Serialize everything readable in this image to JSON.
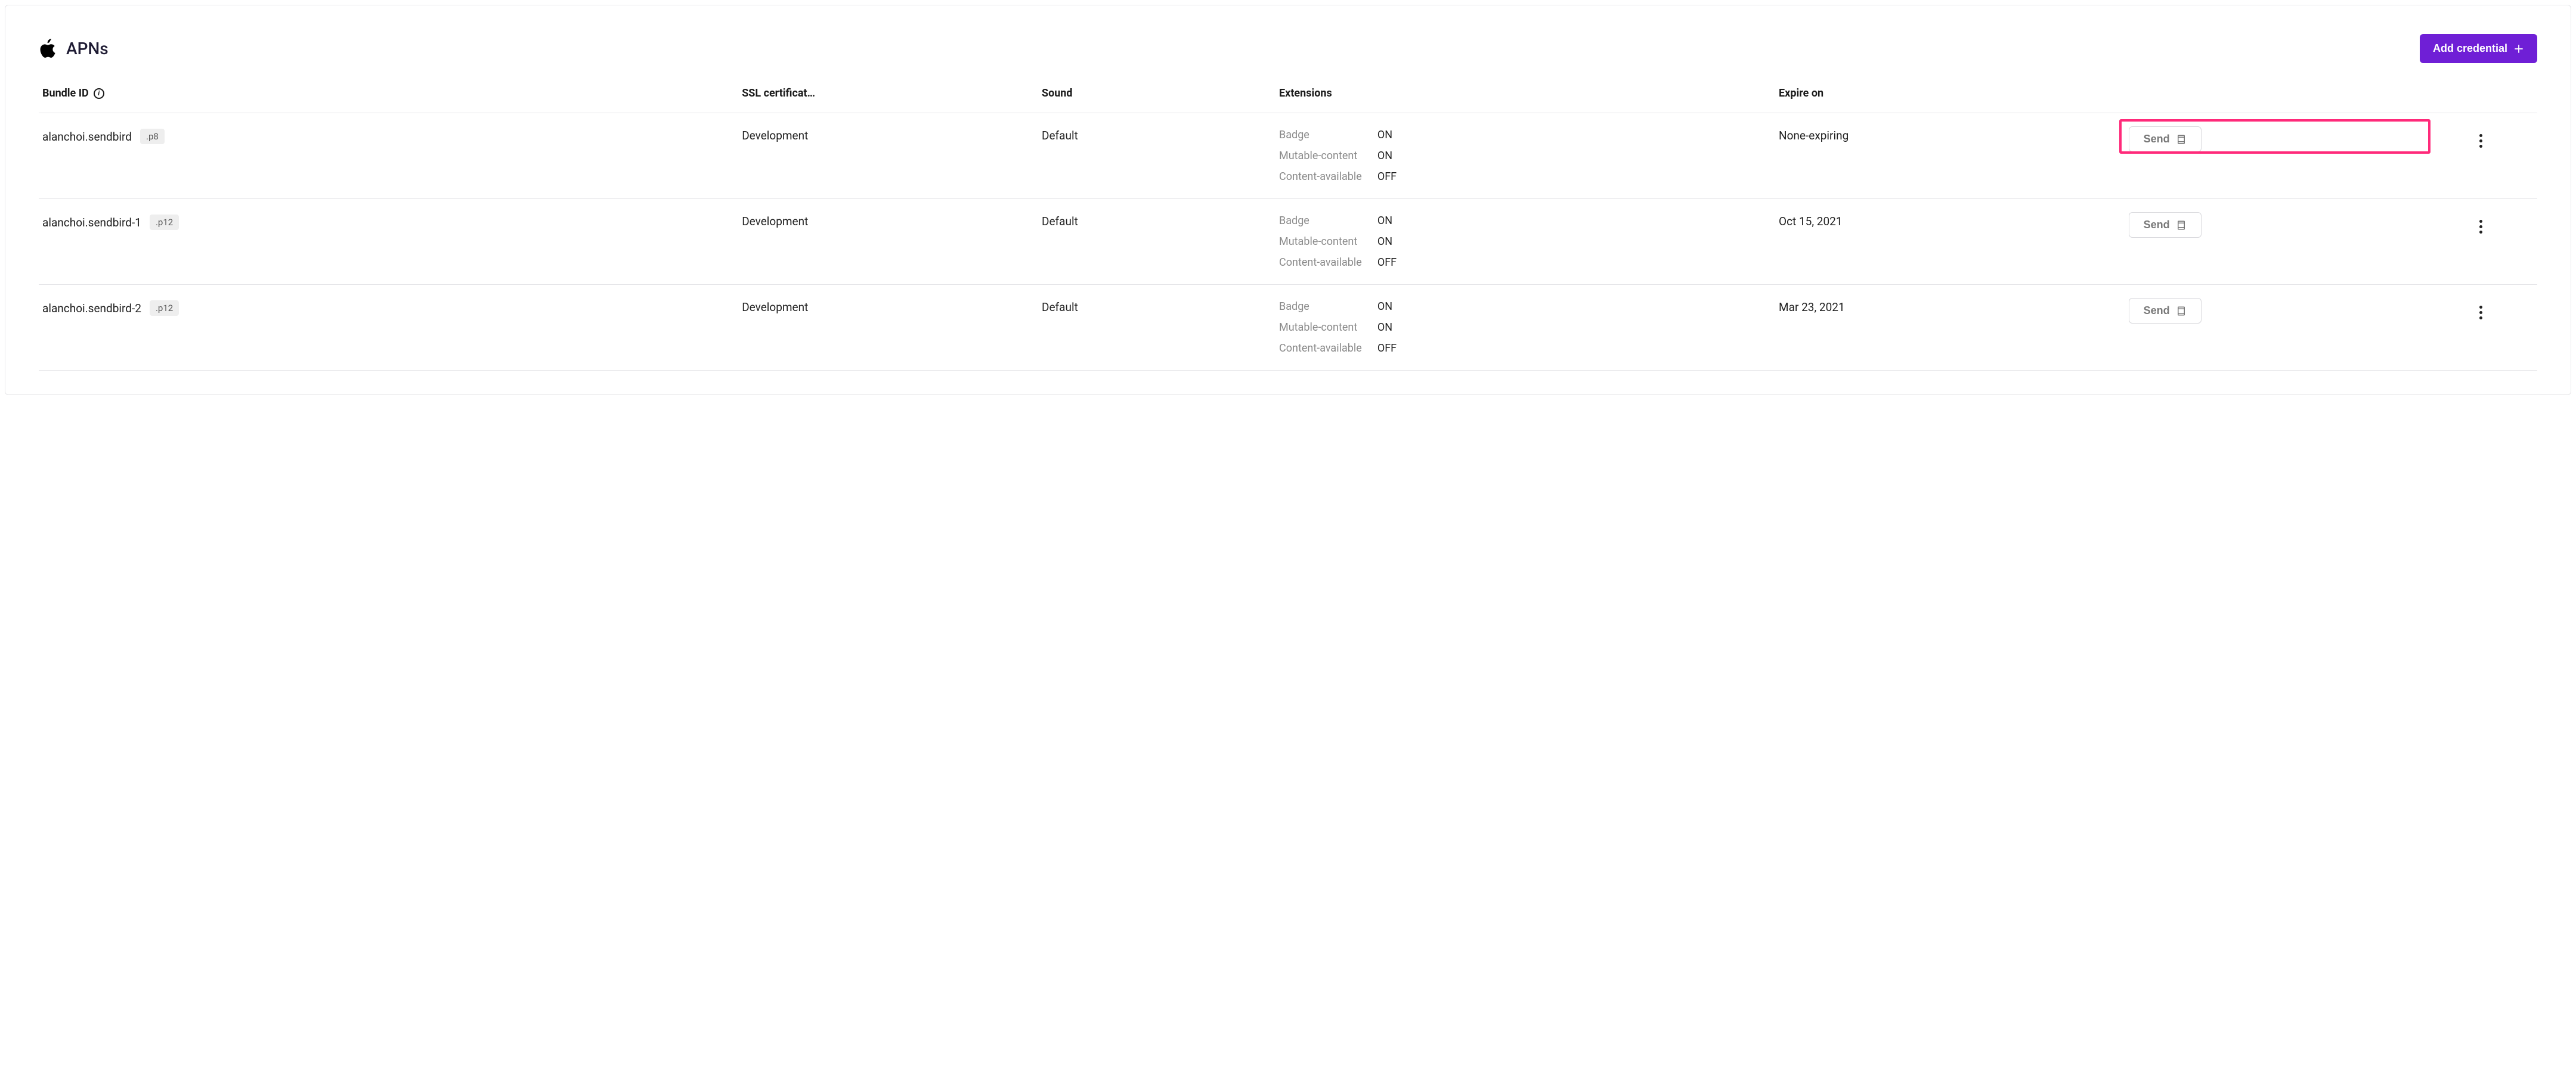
{
  "header": {
    "title": "APNs",
    "add_button_label": "Add credential"
  },
  "columns": {
    "bundle": "Bundle ID",
    "ssl": "SSL certificat…",
    "sound": "Sound",
    "extensions": "Extensions",
    "expire": "Expire on"
  },
  "ext_labels": {
    "badge": "Badge",
    "mutable": "Mutable-content",
    "content": "Content-available"
  },
  "toggle": {
    "on": "ON",
    "off": "OFF"
  },
  "send_label": "Send",
  "rows": [
    {
      "bundle_id": "alanchoi.sendbird",
      "ext_tag": ".p8",
      "ssl": "Development",
      "sound": "Default",
      "ext": {
        "badge": "ON",
        "mutable": "ON",
        "content": "OFF"
      },
      "expire": "None-expiring",
      "highlight": true
    },
    {
      "bundle_id": "alanchoi.sendbird-1",
      "ext_tag": ".p12",
      "ssl": "Development",
      "sound": "Default",
      "ext": {
        "badge": "ON",
        "mutable": "ON",
        "content": "OFF"
      },
      "expire": "Oct 15, 2021",
      "highlight": false
    },
    {
      "bundle_id": "alanchoi.sendbird-2",
      "ext_tag": ".p12",
      "ssl": "Development",
      "sound": "Default",
      "ext": {
        "badge": "ON",
        "mutable": "ON",
        "content": "OFF"
      },
      "expire": "Mar 23, 2021",
      "highlight": false
    }
  ]
}
